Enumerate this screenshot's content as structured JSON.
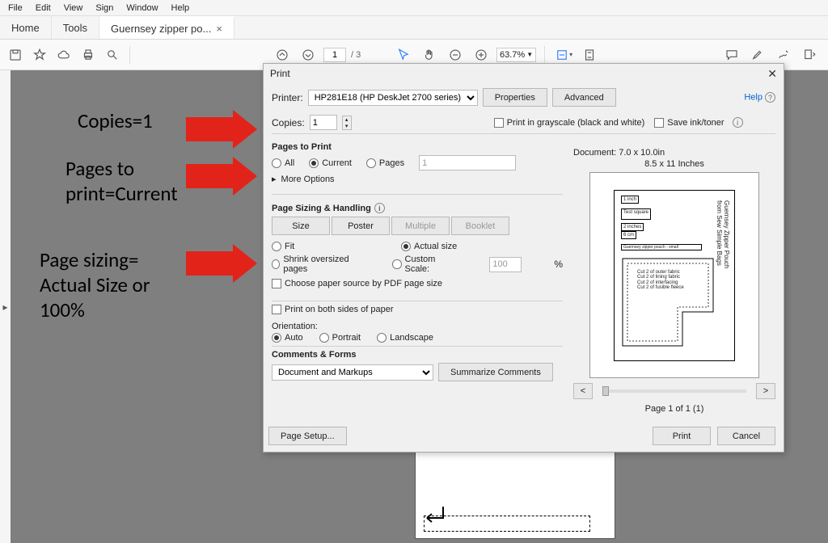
{
  "menubar": [
    "File",
    "Edit",
    "View",
    "Sign",
    "Window",
    "Help"
  ],
  "tabs": {
    "home": "Home",
    "tools": "Tools",
    "doc": "Guernsey zipper po..."
  },
  "toolbar": {
    "page_cur": "1",
    "page_total": "3",
    "zoom": "63.7%"
  },
  "dialog": {
    "title": "Print",
    "printer_label": "Printer:",
    "printer_value": "HP281E18 (HP DeskJet 2700 series)",
    "properties": "Properties",
    "advanced": "Advanced",
    "help": "Help",
    "copies_label": "Copies:",
    "copies_value": "1",
    "grayscale": "Print in grayscale (black and white)",
    "save_ink": "Save ink/toner",
    "pages_to_print": "Pages to Print",
    "all": "All",
    "current": "Current",
    "pages": "Pages",
    "pages_val": "1",
    "more_options": "More Options",
    "sizing_head": "Page Sizing & Handling",
    "size": "Size",
    "poster": "Poster",
    "multiple": "Multiple",
    "booklet": "Booklet",
    "fit": "Fit",
    "actual": "Actual size",
    "shrink": "Shrink oversized pages",
    "custom": "Custom Scale:",
    "custom_val": "100",
    "pct": "%",
    "paper_source": "Choose paper source by PDF page size",
    "duplex": "Print on both sides of paper",
    "orientation": "Orientation:",
    "auto": "Auto",
    "portrait": "Portrait",
    "landscape": "Landscape",
    "comments_head": "Comments & Forms",
    "comments_val": "Document and Markups",
    "summarize": "Summarize Comments",
    "doc_dim": "Document: 7.0 x 10.0in",
    "sheet_dim": "8.5 x 11 Inches",
    "preview_nav": "Page 1 of 1 (1)",
    "page_setup": "Page Setup...",
    "print": "Print",
    "cancel": "Cancel",
    "pouch_title": "Guernsey Zipper Pouch",
    "pouch_sub": "from Sew Simple Bags",
    "cut1": "Cut 2 of outer fabric",
    "cut2": "Cut 2 of lining fabric",
    "cut3": "Cut 2 of interfacing",
    "cut4": "Cut 2 of fusible fleece",
    "test_sq": "Test square",
    "one_inch": "1 inch",
    "two_in": "2 inches",
    "six_cm": "6 cm",
    "label_small": "Guernsey zipper pouch - small"
  },
  "annotations": {
    "copies": "Copies=1",
    "pages": "Pages to\nprint=Current",
    "sizing": "Page sizing=\nActual Size or\n100%"
  }
}
